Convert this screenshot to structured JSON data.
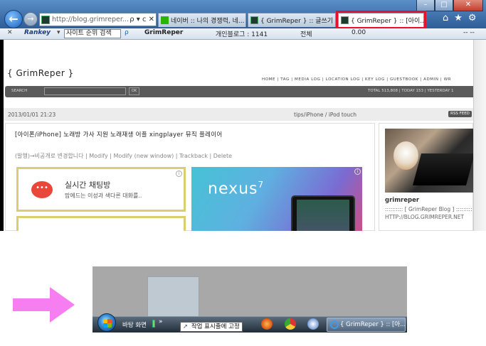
{
  "browser": {
    "address_url": "http://blog.grimreper....",
    "tabs": [
      {
        "label": "네이버 :: 나의 경쟁력, 네..."
      },
      {
        "label": "{ GrimReper } :: 글쓰기"
      },
      {
        "label": "{ GrimReper } :: [아이..."
      }
    ],
    "window_controls": {
      "minimize": "–",
      "maximize": "□",
      "close": "✕"
    },
    "back_glyph": "←",
    "forward_glyph": "→",
    "address_controls": "ρ ▾ c ✕",
    "tab_close": "✕",
    "tool_glyphs": {
      "home": "⌂",
      "favorites": "★",
      "settings": "⚙"
    },
    "highlight_color": "#e8102a"
  },
  "toolbar": {
    "close_glyph": "✕",
    "brand": "Rankey",
    "brand_caret": "▾",
    "search_text": "사이트 순위 검색",
    "search_glyph": "ρ",
    "site": "GrimReper",
    "personal_blog": "개인블로그 : 1141",
    "total": "전체",
    "score": "0.00",
    "weather": "-- --"
  },
  "blog": {
    "title": "{ GrimReper }",
    "nav": "HOME  |  TAG  |  MEDIA LOG  |  LOCATION LOG  |  KEY LOG  |  GUESTBOOK  |  ADMIN  |  WR",
    "search_label": "SEARCH",
    "ok_label": "OK",
    "stats": "TOTAL 513,808  |  TODAY 153  |  YESTERDAY 1",
    "post_date": "2013/01/01 21:23",
    "category": "tips/iPhone / iPod touch",
    "rss": "RSS FEED",
    "post_title": "[아이폰/iPhone] 노래방 가사 지원 노래재생 어플 xingplayer 뮤직 플레이어",
    "post_actions": "(발행)→비공개로 변경합니다 | Modify | Modify (new window) | Trackback | Delete",
    "ad_chat_title": "실시간 채팅방",
    "ad_chat_sub": "맘에드는 이성과 색다른 대화를..",
    "ad_chat_bubble": "•••",
    "ad_info": "i",
    "ad_nexus": "nexus",
    "ad_nexus_sup": "7",
    "profile_name": "grimreper",
    "profile_desc": ":::::::::: [ GrimReper Blog ] :::::::::",
    "profile_url": "HTTP://BLOG.GRIMREPER.NET"
  },
  "taskbar": {
    "desktop_label": "바탕 화면",
    "chevron": "»",
    "pin_tooltip": "작업 표시줄에 고정",
    "pin_glyph": "➚",
    "active_window": "{ GrimReper } :: [아..."
  },
  "colors": {
    "arrow": "#f77ef0",
    "highlight": "#e8102a"
  }
}
